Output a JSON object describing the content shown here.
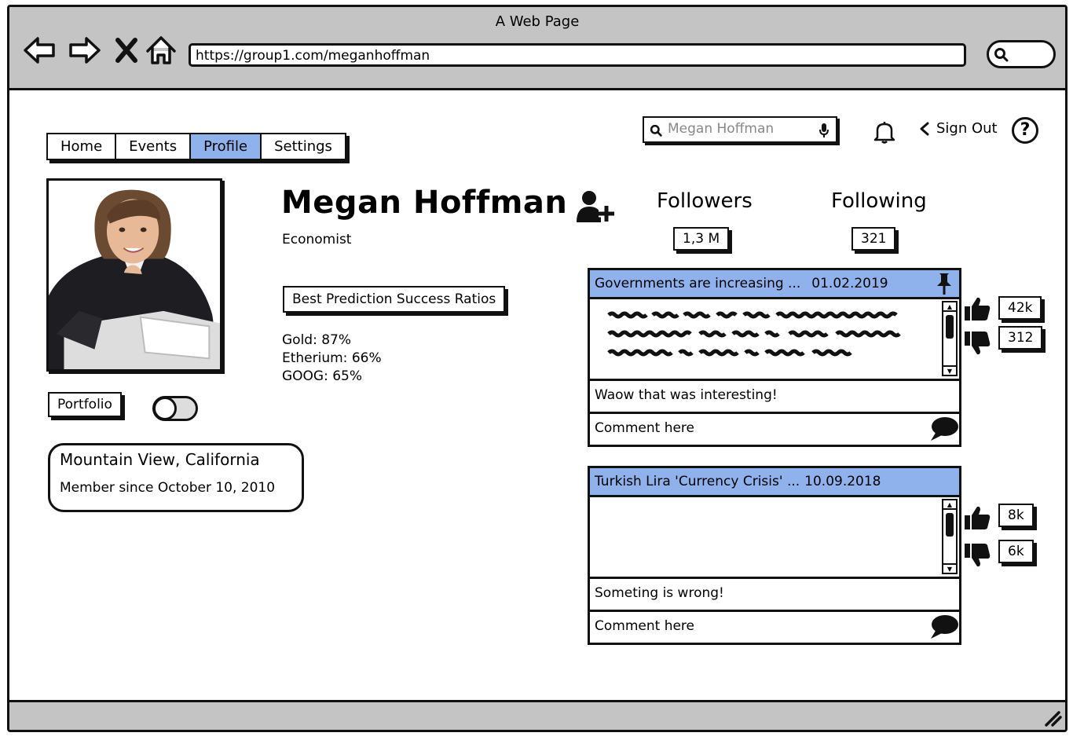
{
  "window": {
    "title": "A Web Page"
  },
  "browser": {
    "url": "https://group1.com/meganhoffman",
    "nav_icons": [
      "back-arrow-icon",
      "forward-arrow-icon",
      "close-icon",
      "home-icon"
    ],
    "search_icon": "search-icon"
  },
  "nav": {
    "tabs": [
      {
        "label": "Home",
        "active": false
      },
      {
        "label": "Events",
        "active": false
      },
      {
        "label": "Profile",
        "active": true
      },
      {
        "label": "Settings",
        "active": false
      }
    ]
  },
  "header": {
    "search_placeholder": "Megan Hoffman",
    "sign_out": "Sign Out",
    "help": "?"
  },
  "profile": {
    "name": "Megan Hoffman",
    "profession": "Economist",
    "best_button": "Best Prediction Success Ratios",
    "ratios": [
      "Gold: 87%",
      "Etherium: 66%",
      "GOOG: 65%"
    ],
    "portfolio_button": "Portfolio",
    "location": "Mountain View, California",
    "member_since": "Member since October 10, 2010"
  },
  "stats": {
    "followers_label": "Followers",
    "followers_value": "1,3 M",
    "following_label": "Following",
    "following_value": "321"
  },
  "posts": [
    {
      "title": "Governments are increasing ...",
      "date": "01.02.2019",
      "reply": "Waow that was interesting!",
      "comment_placeholder": "Comment here",
      "likes": "42k",
      "dislikes": "312"
    },
    {
      "title": "Turkish Lira 'Currency Crisis' ...",
      "date": "10.09.2018",
      "reply": "Someting is wrong!",
      "comment_placeholder": "Comment here",
      "likes": "8k",
      "dislikes": "6k"
    }
  ],
  "colors": {
    "accent": "#8fb1ec",
    "chrome": "#c4c4c4",
    "ink": "#111111"
  }
}
